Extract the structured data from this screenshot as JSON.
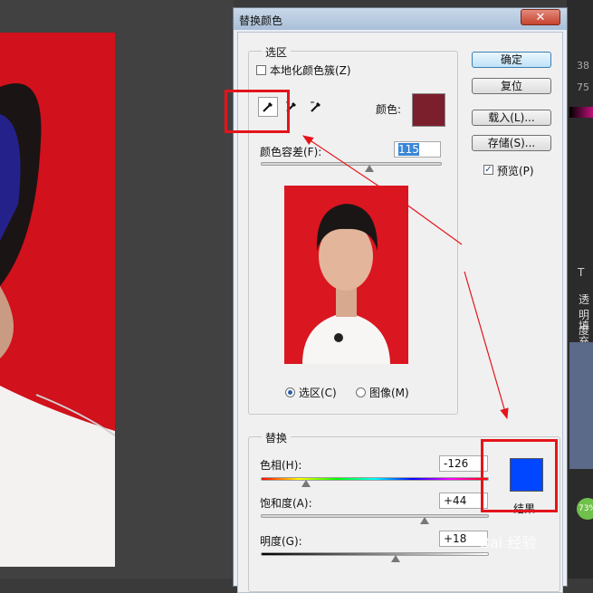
{
  "dialog": {
    "title": "替换颜色",
    "close_icon": "close-icon"
  },
  "selection": {
    "legend": "选区",
    "localized_clusters_label": "本地化颜色簇(Z)",
    "localized_clusters_checked": false,
    "color_label": "颜色:",
    "selected_color": "#7b1f2c",
    "fuzziness_label": "颜色容差(F):",
    "fuzziness_value": "115",
    "fuzziness_level": 0.6,
    "tools": [
      "eyedropper-icon",
      "eyedropper-plus-icon",
      "eyedropper-minus-icon"
    ],
    "preview_mode_selection": "选区(C)",
    "preview_mode_image": "图像(M)"
  },
  "buttons": {
    "ok": "确定",
    "reset": "复位",
    "load": "载入(L)...",
    "save": "存储(S)...",
    "preview_label": "预览(P)",
    "preview_checked": true
  },
  "replacement": {
    "legend": "替换",
    "hue_label": "色相(H):",
    "hue_value": "-126",
    "hue_level": 0.2,
    "saturation_label": "饱和度(A):",
    "saturation_value": "+44",
    "saturation_level": 0.72,
    "lightness_label": "明度(G):",
    "lightness_value": "+18",
    "lightness_level": 0.59,
    "result_label": "结果",
    "result_color": "#0047ff"
  },
  "right_panel": {
    "items": [
      "38",
      "75",
      "T",
      "透明度",
      "填充",
      "73%"
    ]
  },
  "watermark": "Bai 经验"
}
